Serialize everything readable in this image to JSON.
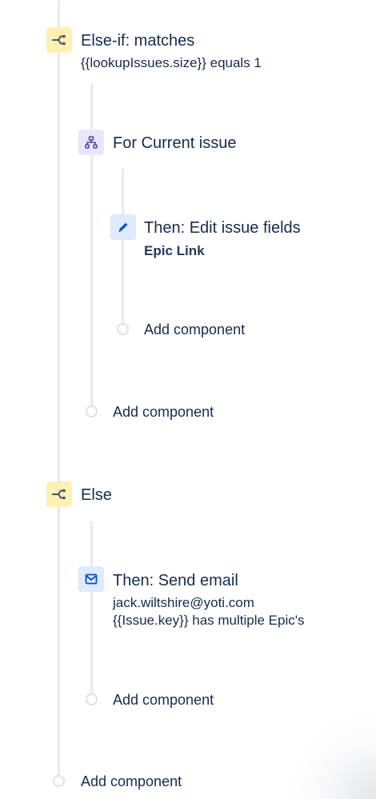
{
  "else_if_block": {
    "title": "Else-if: matches",
    "condition": "{{lookupIssues.size}} equals 1",
    "icon": "branch-icon"
  },
  "for_block": {
    "title": "For Current issue",
    "icon": "hierarchy-icon"
  },
  "edit_action": {
    "title": "Then: Edit issue fields",
    "field": "Epic Link",
    "icon": "pencil-icon"
  },
  "else_block": {
    "title": "Else",
    "icon": "branch-icon"
  },
  "email_action": {
    "title": "Then: Send email",
    "recipient": "jack.wiltshire@yoti.com",
    "subject": "{{Issue.key}} has multiple Epic's",
    "icon": "envelope-icon"
  },
  "add_component_label": "Add component",
  "colors": {
    "text": "#172b4d",
    "branch_bg": "#fff0b3",
    "branch_icon": "#42526e",
    "for_bg": "#eae6ff",
    "for_icon": "#5243aa",
    "action_bg": "#deebff",
    "action_icon": "#0052cc",
    "connector": "#e8eaee"
  }
}
